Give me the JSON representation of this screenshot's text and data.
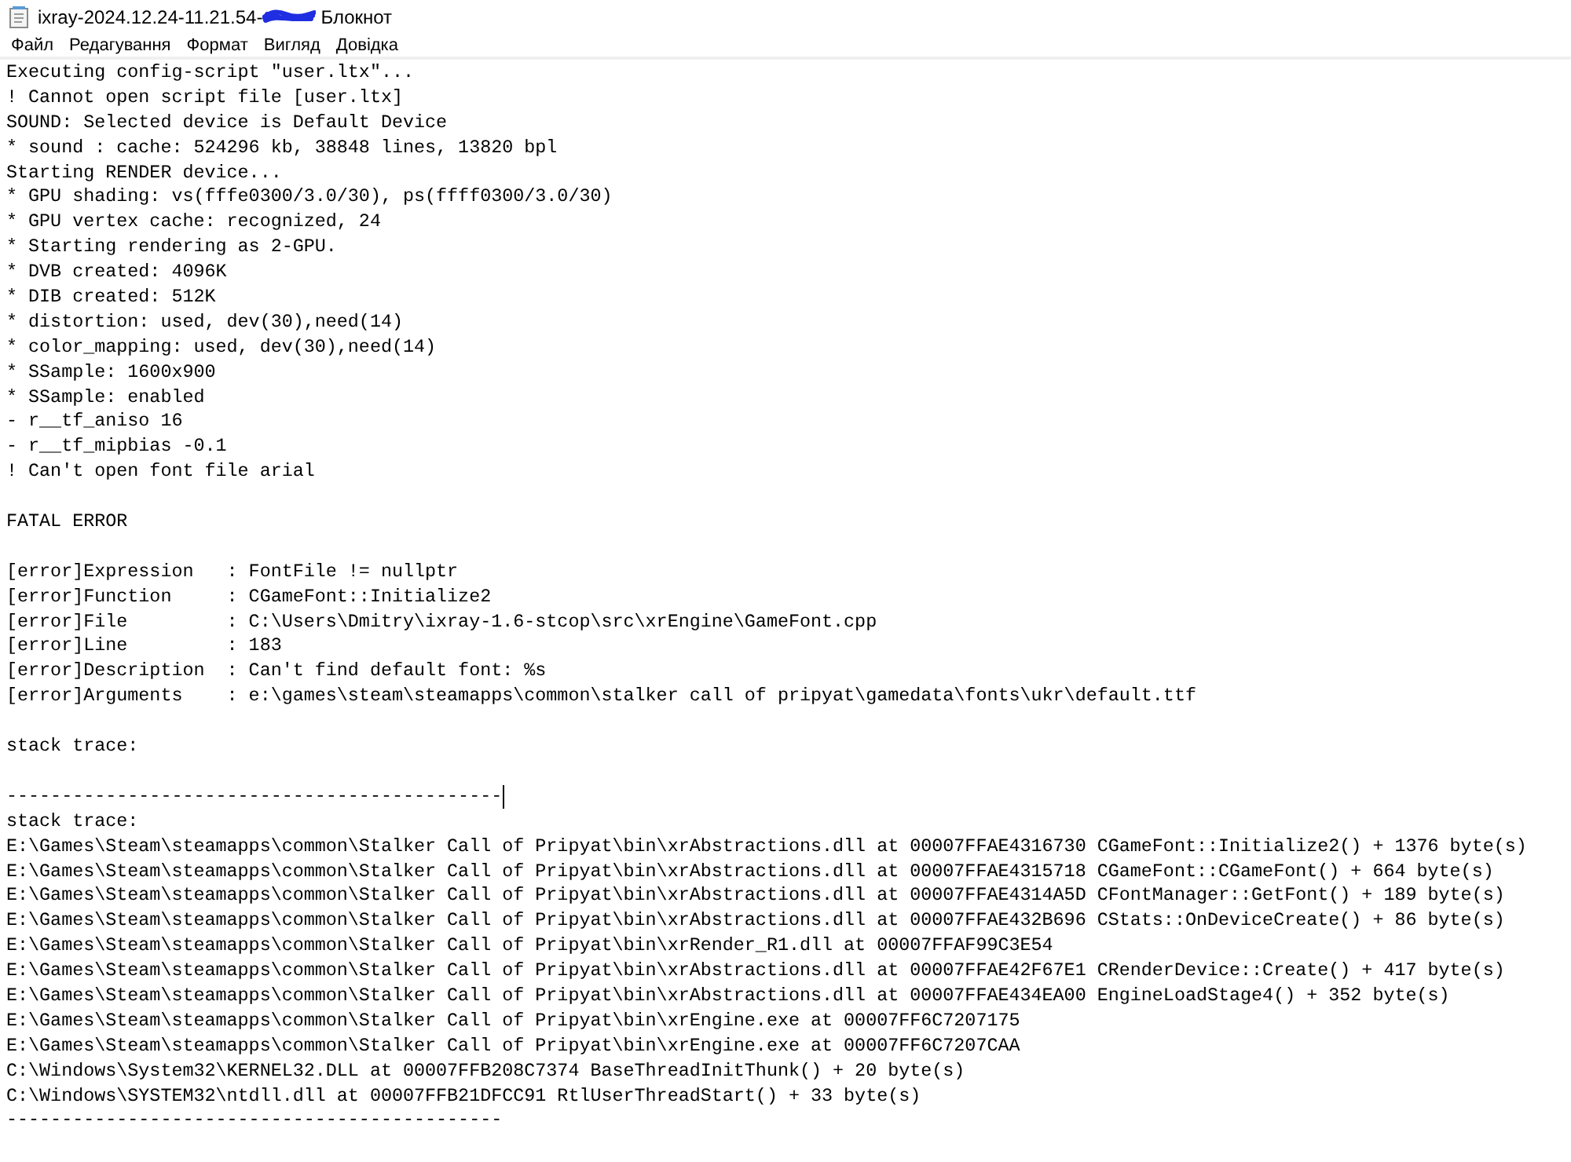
{
  "window": {
    "title_start": "ixray-2024.12.24-11.21.54-",
    "title_end": "Блокнот"
  },
  "menu": [
    "Файл",
    "Редагування",
    "Формат",
    "Вигляд",
    "Довідка"
  ],
  "blocks": [
    [
      {
        "text": "Executing config-script \"user.ltx\"...",
        "caret": false
      },
      {
        "text": "! Cannot open script file [user.ltx]",
        "caret": false
      },
      {
        "text": "SOUND: Selected device is Default Device",
        "caret": false
      },
      {
        "text": "* sound : cache: 524296 kb, 38848 lines, 13820 bpl",
        "caret": false
      },
      {
        "text": "Starting RENDER device...",
        "caret": false
      },
      {
        "text": "* GPU shading: vs(fffe0300/3.0/30), ps(ffff0300/3.0/30)",
        "caret": false
      },
      {
        "text": "* GPU vertex cache: recognized, 24",
        "caret": false
      },
      {
        "text": "* Starting rendering as 2-GPU.",
        "caret": false
      },
      {
        "text": "* DVB created: 4096K",
        "caret": false
      },
      {
        "text": "* DIB created: 512K",
        "caret": false
      },
      {
        "text": "* distortion: used, dev(30),need(14)",
        "caret": false
      },
      {
        "text": "* color_mapping: used, dev(30),need(14)",
        "caret": false
      },
      {
        "text": "* SSample: 1600x900",
        "caret": false
      },
      {
        "text": "* SSample: enabled",
        "caret": false
      },
      {
        "text": "- r__tf_aniso 16",
        "caret": false
      },
      {
        "text": "- r__tf_mipbias -0.1",
        "caret": false
      },
      {
        "text": "! Can't open font file arial",
        "caret": false
      }
    ],
    [
      {
        "text": "FATAL ERROR",
        "caret": false
      }
    ],
    [
      {
        "text": "[error]Expression   : FontFile != nullptr",
        "caret": false
      },
      {
        "text": "[error]Function     : CGameFont::Initialize2",
        "caret": false
      },
      {
        "text": "[error]File         : C:\\Users\\Dmitry\\ixray-1.6-stcop\\src\\xrEngine\\GameFont.cpp",
        "caret": false
      },
      {
        "text": "[error]Line         : 183",
        "caret": false
      },
      {
        "text": "[error]Description  : Can't find default font: %s",
        "caret": false
      },
      {
        "text": "[error]Arguments    : e:\\games\\steam\\steamapps\\common\\stalker call of pripyat\\gamedata\\fonts\\ukr\\default.ttf",
        "caret": false
      }
    ],
    [
      {
        "text": "stack trace:",
        "caret": false
      }
    ],
    [
      {
        "text": "---------------------------------------------",
        "caret": true
      },
      {
        "text": "stack trace:",
        "caret": false
      },
      {
        "text": "E:\\Games\\Steam\\steamapps\\common\\Stalker Call of Pripyat\\bin\\xrAbstractions.dll at 00007FFAE4316730 CGameFont::Initialize2() + 1376 byte(s)",
        "caret": false
      },
      {
        "text": "E:\\Games\\Steam\\steamapps\\common\\Stalker Call of Pripyat\\bin\\xrAbstractions.dll at 00007FFAE4315718 CGameFont::CGameFont() + 664 byte(s)",
        "caret": false
      },
      {
        "text": "E:\\Games\\Steam\\steamapps\\common\\Stalker Call of Pripyat\\bin\\xrAbstractions.dll at 00007FFAE4314A5D CFontManager::GetFont() + 189 byte(s)",
        "caret": false
      },
      {
        "text": "E:\\Games\\Steam\\steamapps\\common\\Stalker Call of Pripyat\\bin\\xrAbstractions.dll at 00007FFAE432B696 CStats::OnDeviceCreate() + 86 byte(s)",
        "caret": false
      },
      {
        "text": "E:\\Games\\Steam\\steamapps\\common\\Stalker Call of Pripyat\\bin\\xrRender_R1.dll at 00007FFAF99C3E54",
        "caret": false
      },
      {
        "text": "E:\\Games\\Steam\\steamapps\\common\\Stalker Call of Pripyat\\bin\\xrAbstractions.dll at 00007FFAE42F67E1 CRenderDevice::Create() + 417 byte(s)",
        "caret": false
      },
      {
        "text": "E:\\Games\\Steam\\steamapps\\common\\Stalker Call of Pripyat\\bin\\xrAbstractions.dll at 00007FFAE434EA00 EngineLoadStage4() + 352 byte(s)",
        "caret": false
      },
      {
        "text": "E:\\Games\\Steam\\steamapps\\common\\Stalker Call of Pripyat\\bin\\xrEngine.exe at 00007FF6C7207175",
        "caret": false
      },
      {
        "text": "E:\\Games\\Steam\\steamapps\\common\\Stalker Call of Pripyat\\bin\\xrEngine.exe at 00007FF6C7207CAA",
        "caret": false
      },
      {
        "text": "C:\\Windows\\System32\\KERNEL32.DLL at 00007FFB208C7374 BaseThreadInitThunk() + 20 byte(s)",
        "caret": false
      },
      {
        "text": "C:\\Windows\\SYSTEM32\\ntdll.dll at 00007FFB21DFCC91 RtlUserThreadStart() + 33 byte(s)",
        "caret": false
      },
      {
        "text": "---------------------------------------------",
        "caret": false
      }
    ]
  ]
}
